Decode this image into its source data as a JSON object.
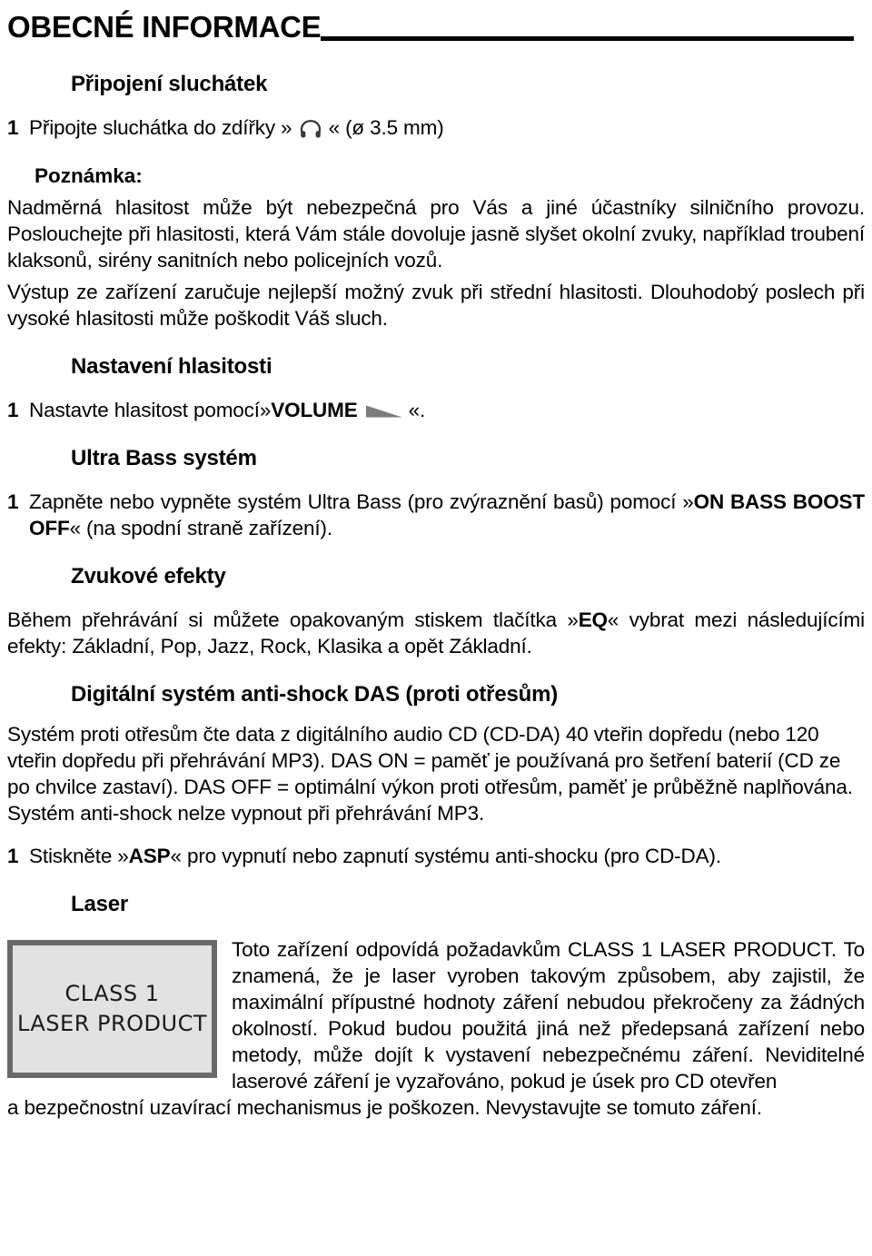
{
  "header": {
    "title": "OBECNÉ INFORMACE"
  },
  "sections": {
    "headphones": {
      "heading": "Připojení sluchátek",
      "step_num": "1",
      "step_before_icon": "Připojte sluchátka do zdířky »",
      "icon": "headphone-icon",
      "step_after_icon": "« (ø 3.5 mm)"
    },
    "note": {
      "label": "Poznámka:",
      "paragraph1": "Nadměrná hlasitost může být nebezpečná pro Vás a jiné účastníky silničního provozu. Poslouchejte při hlasitosti, která Vám stále dovoluje jasně slyšet okolní zvuky, například troubení klaksonů, sirény sanitních nebo policejních vozů.",
      "paragraph2": "Výstup ze zařízení zaručuje nejlepší možný zvuk při střední hlasitosti. Dlouhodobý poslech při vysoké hlasitosti může poškodit Váš sluch."
    },
    "volume": {
      "heading": "Nastavení hlasitosti",
      "step_num": "1",
      "step_before_kw": "Nastavte hlasitost pomocí»",
      "keyword": "VOLUME",
      "icon": "volume-wedge-icon",
      "step_after_icon": "«."
    },
    "ultra_bass": {
      "heading": "Ultra Bass systém",
      "step_num": "1",
      "step_part1": "Zapněte nebo vypněte systém Ultra Bass (pro zvýraznění basů) pomocí »",
      "keyword": "ON BASS BOOST OFF",
      "step_part2": "« (na spodní straně zařízení)."
    },
    "sound_effects": {
      "heading": "Zvukové efekty",
      "text_part1": "Během přehrávání si můžete opakovaným stiskem tlačítka »",
      "keyword": "EQ",
      "text_part2": "« vybrat mezi následujícími efekty: Základní, Pop, Jazz, Rock, Klasika a opět Základní."
    },
    "das": {
      "heading": "Digitální systém anti-shock DAS (proti otřesům)",
      "paragraph1": "Systém proti otřesům čte data z digitálního audio  CD (CD-DA) 40 vteřin dopředu (nebo 120 vteřin dopředu při přehrávání MP3). DAS ON = paměť je používaná pro šetření baterií (CD ze po chvilce zastaví). DAS OFF = optimální výkon proti otřesům, paměť je průběžně naplňována.",
      "paragraph2": "Systém anti-shock nelze vypnout při přehrávání MP3.",
      "step_num": "1",
      "step_part1": "Stiskněte »",
      "keyword": "ASP",
      "step_part2": "« pro vypnutí nebo zapnutí systému anti-shocku (pro CD-DA)."
    },
    "laser": {
      "heading": "Laser",
      "figure": {
        "line1": "CLASS 1",
        "line2": "LASER PRODUCT",
        "border_color": "#696969",
        "fill_color": "#e2e2e2"
      },
      "text": "Toto zařízení odpovídá požadavkům CLASS 1 LASER PRODUCT. To znamená, že je laser vyroben takovým způsobem, aby zajistil, že maximální přípustné hodnoty záření nebudou překročeny za žádných okolností. Pokud budou použitá jiná než předepsaná zařízení nebo metody, může dojít k vystavení nebezpečnému záření. Neviditelné laserové záření je vyzařováno, pokud je úsek pro CD otevřen",
      "tail": "a bezpečnostní uzavírací mechanismus je poškozen. Nevystavujte se tomuto záření."
    }
  }
}
